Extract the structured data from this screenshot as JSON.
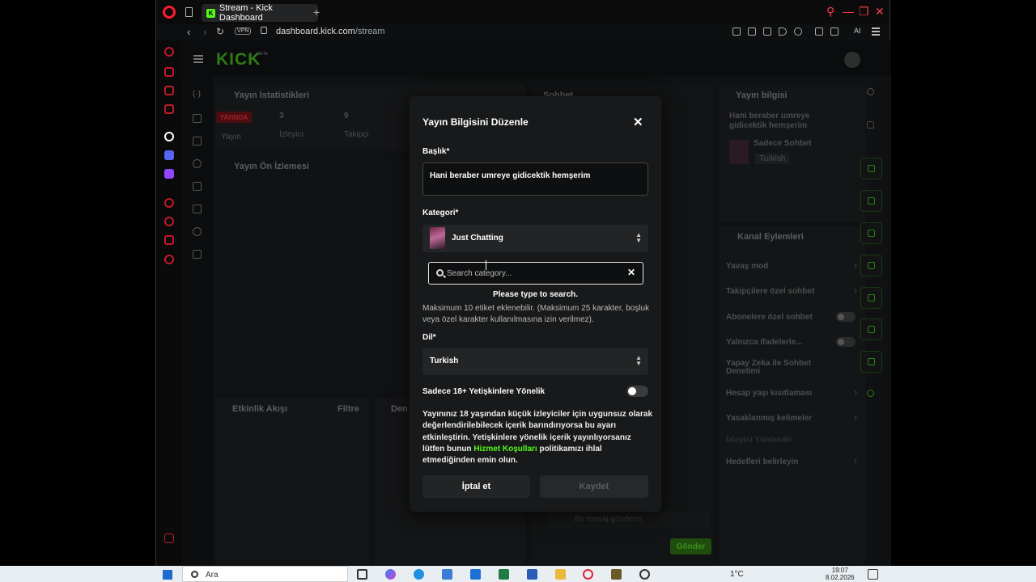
{
  "browser": {
    "tab_title": "Stream - Kick Dashboard",
    "new_tab": "+",
    "vpn": "VPN",
    "url_host": "dashboard.kick.com",
    "url_path": "/stream",
    "ai_label": "AI"
  },
  "kick": {
    "logo": "KICK",
    "beta": "BETA",
    "stats_panel": {
      "title": "Yayın İstatistikleri",
      "live_badge": "YAYINDA",
      "viewers_value": "3",
      "viewers_label": "İzleyici",
      "followers_value": "9",
      "followers_label": "Takipçi",
      "stream_label": "Yayın"
    },
    "preview_panel": {
      "title": "Yayın Ön İzlemesi"
    },
    "chat_panel": {
      "title": "Sohbet",
      "input_placeholder": "Bir mesaj gönderin",
      "send_button": "Gönder"
    },
    "activity_panel": {
      "title": "Etkinlik Akışı",
      "filter": "Filtre",
      "next": "Den"
    },
    "info_panel": {
      "title": "Yayın bilgisi",
      "stream_title": "Hani beraber umreye gidicektik hemşerim",
      "category": "Sadece Sohbet",
      "language": "Turkish"
    },
    "channel_actions": {
      "title": "Kanal Eylemleri",
      "items": [
        "Yavaş mod",
        "Takipçilere özel sohbet",
        "Abonelere özel sohbet",
        "Yalnızca ifadelerle...",
        "Yapay Zeka ile Sohbet Denetimi",
        "Hesap yaşı kısıtlaması",
        "Yasaklanmış kelimeler",
        "İzleyici Yönlendir",
        "Hedefleri belirleyin"
      ]
    }
  },
  "modal": {
    "title": "Yayın Bilgisini Düzenle",
    "title_label": "Başlık*",
    "title_value": "Hani beraber umreye gidicektik hemşerim",
    "category_label": "Kategori*",
    "category_value": "Just Chatting",
    "search_placeholder": "Search category...",
    "search_empty": "Please type to search.",
    "tags_hint": "Maksimum 10 etiket eklenebilir. (Maksimum 25 karakter, boşluk veya özel karakter kullanılmasına izin verilmez).",
    "language_label": "Dil*",
    "language_value": "Turkish",
    "adult_label": "Sadece 18+ Yetişkinlere Yönelik",
    "adult_desc_1": "Yayınınız 18 yaşından küçük izleyiciler için uygunsuz olarak değerlendirilebilecek içerik barındırıyorsa bu ayarı etkinleştirin. Yetişkinlere yönelik içerik yayınlıyorsanız lütfen bunun ",
    "adult_desc_link": "Hizmet Koşulları",
    "adult_desc_2": " politikamızı ihlal etmediğinden emin olun.",
    "cancel_button": "İptal et",
    "save_button": "Kaydet"
  },
  "taskbar": {
    "search_label": "Ara",
    "temperature": "1°C",
    "time": "19:07",
    "date": "8.02.2026"
  },
  "colors": {
    "kick_green": "#53fc18",
    "opera_red": "#ff1b2d"
  }
}
